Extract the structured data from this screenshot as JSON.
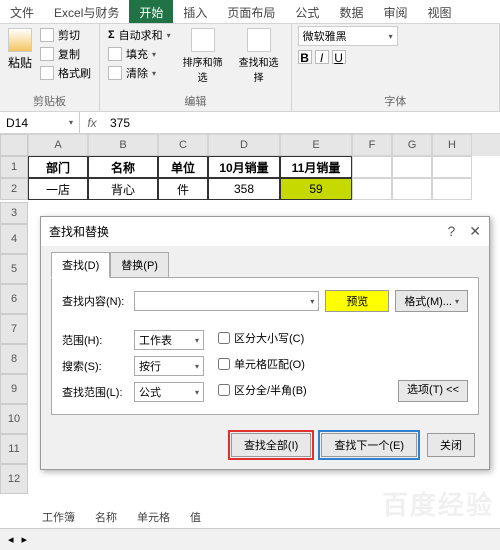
{
  "ribbon": {
    "tabs": [
      "文件",
      "Excel与财务",
      "开始",
      "插入",
      "页面布局",
      "公式",
      "数据",
      "审阅",
      "视图"
    ],
    "active_tab": "开始",
    "clipboard": {
      "paste": "粘贴",
      "cut": "剪切",
      "copy": "复制",
      "format_painter": "格式刷",
      "group": "剪贴板"
    },
    "editing": {
      "autosum": "自动求和",
      "fill": "填充",
      "clear": "清除",
      "group": "编辑"
    },
    "sortfind": {
      "sort": "排序和筛选",
      "find": "查找和选择"
    },
    "font": {
      "name": "微软雅黑",
      "group": "字体"
    }
  },
  "namebox": "D14",
  "formula": "375",
  "fx_label": "fx",
  "columns": [
    "A",
    "B",
    "C",
    "D",
    "E",
    "F",
    "G",
    "H"
  ],
  "rows": [
    "1",
    "2",
    "3",
    "4",
    "5",
    "6",
    "7",
    "8",
    "9",
    "10",
    "11",
    "12"
  ],
  "table": {
    "header": [
      "部门",
      "名称",
      "单位",
      "10月销量",
      "11月销量"
    ],
    "row1": [
      "一店",
      "背心",
      "件",
      "358",
      "59"
    ]
  },
  "dialog": {
    "title": "查找和替换",
    "tab_find": "查找(D)",
    "tab_replace": "替换(P)",
    "search_content": "查找内容(N):",
    "preview": "预览",
    "format": "格式(M)...",
    "scope_label": "范围(H):",
    "scope_value": "工作表",
    "search_label": "搜索(S):",
    "search_value": "按行",
    "lookin_label": "查找范围(L):",
    "lookin_value": "公式",
    "match_case": "区分大小写(C)",
    "match_entire": "单元格匹配(O)",
    "match_byte": "区分全/半角(B)",
    "options": "选项(T) <<",
    "find_all": "查找全部(I)",
    "find_next": "查找下一个(E)",
    "close": "关闭"
  },
  "summary": {
    "sheet": "工作簿",
    "name": "名称",
    "cell": "单元格",
    "value": "值"
  },
  "sheets": [
    "工作簿"
  ]
}
